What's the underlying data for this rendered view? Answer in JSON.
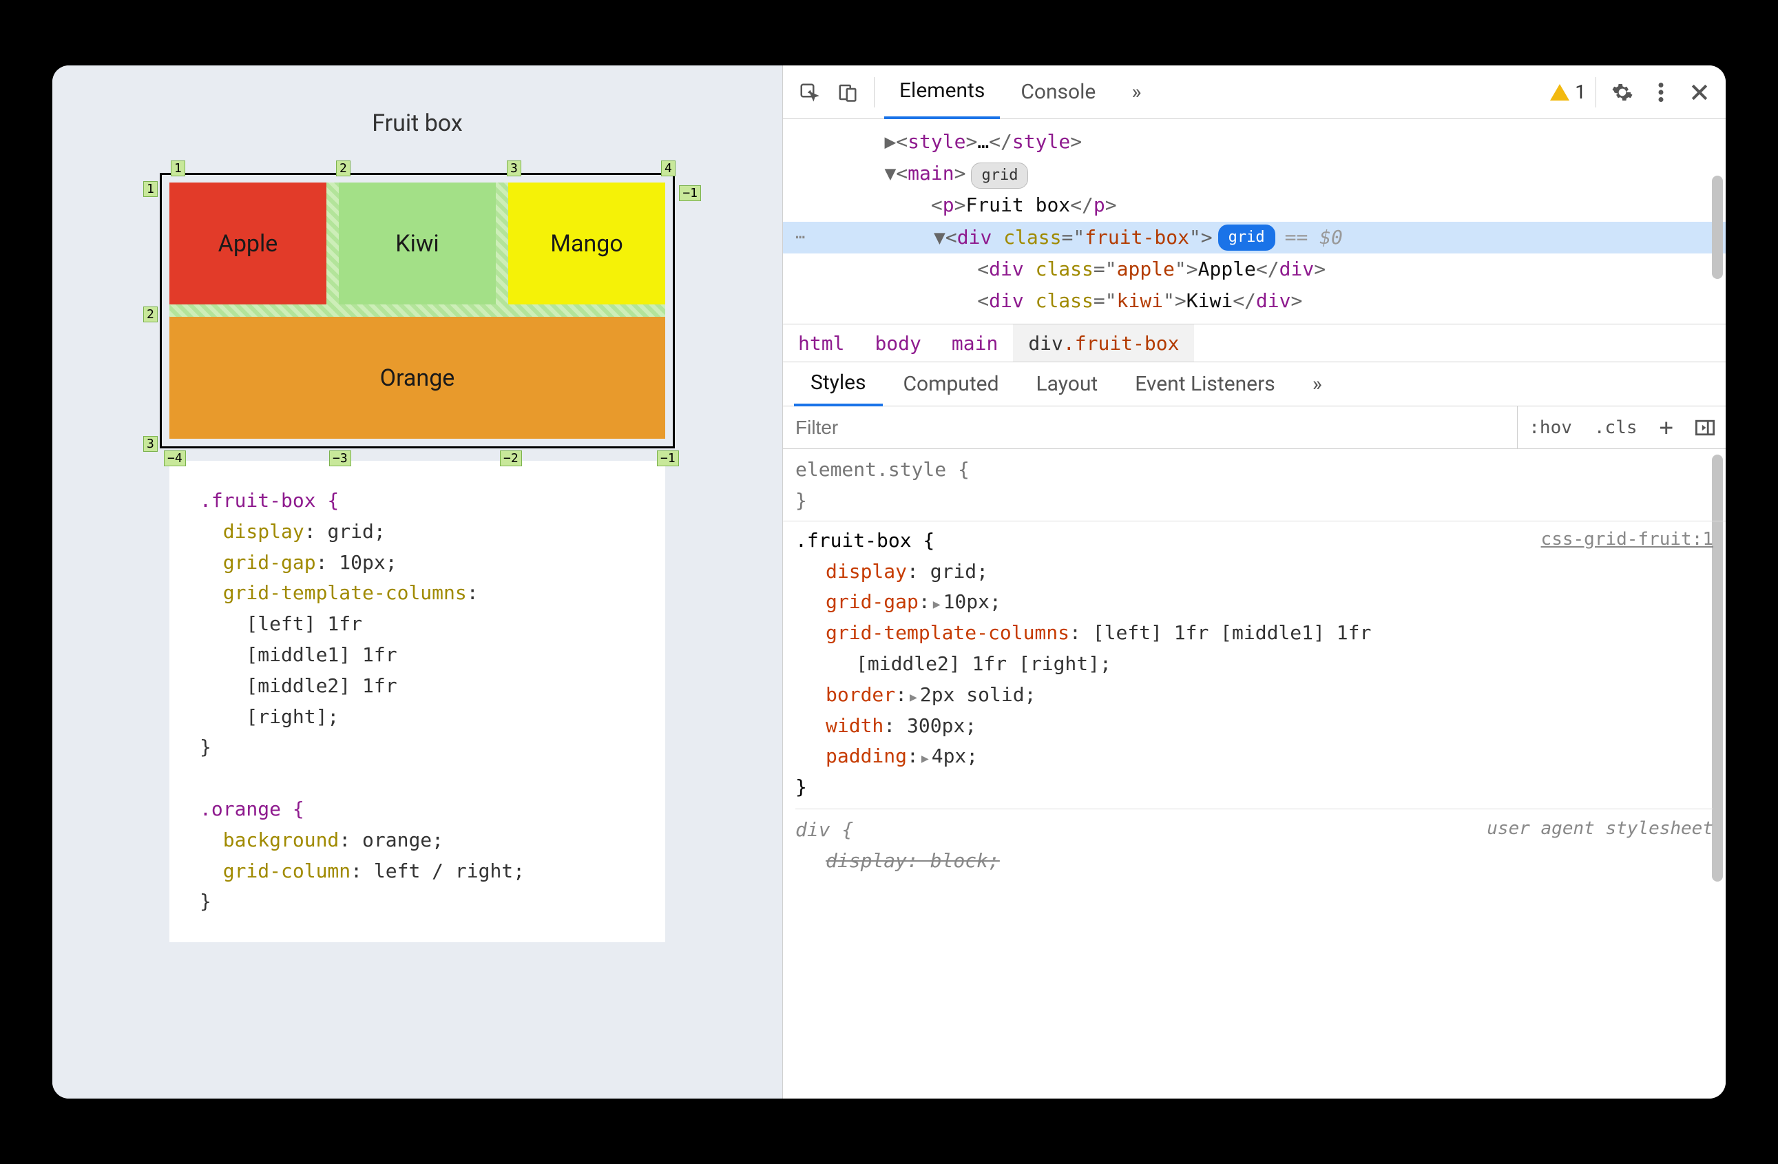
{
  "page": {
    "title": "Fruit box"
  },
  "grid": {
    "cells": {
      "apple": "Apple",
      "kiwi": "Kiwi",
      "mango": "Mango",
      "orange": "Orange"
    },
    "badges": {
      "top": [
        "1",
        "2",
        "3",
        "4"
      ],
      "bottom": [
        "−4",
        "−3",
        "−2",
        "−1"
      ],
      "left": [
        "1",
        "2",
        "3"
      ],
      "right": [
        "−1"
      ]
    }
  },
  "code_left": {
    "rule1_sel": ".fruit-box {",
    "rule1_l1a": "display",
    "rule1_l1b": ": grid;",
    "rule1_l2a": "grid-gap",
    "rule1_l2b": ": 10px;",
    "rule1_l3a": "grid-template-columns",
    "rule1_l3b": ":",
    "rule1_l4": "    [left] 1fr",
    "rule1_l5": "    [middle1] 1fr",
    "rule1_l6": "    [middle2] 1fr",
    "rule1_l7": "    [right];",
    "rule1_close": "}",
    "rule2_sel": ".orange {",
    "rule2_l1a": "background",
    "rule2_l1b": ": orange;",
    "rule2_l2a": "grid-column",
    "rule2_l2b": ": left / right;",
    "rule2_close": "}"
  },
  "devtools": {
    "tabs": {
      "elements": "Elements",
      "console": "Console",
      "more": "»"
    },
    "warning_count": "1",
    "dom": {
      "l1": {
        "toggle": "▶",
        "o": "<",
        "tag": "style",
        "c": ">",
        "dots": "…",
        "o2": "</",
        "tag2": "style",
        "c2": ">"
      },
      "l2": {
        "toggle": "▼",
        "o": "<",
        "tag": "main",
        "c": ">",
        "pill": "grid"
      },
      "l3": {
        "o": "<",
        "tag": "p",
        "c": ">",
        "txt": "Fruit box",
        "o2": "</",
        "tag2": "p",
        "c2": ">"
      },
      "l4": {
        "ell": "⋯",
        "toggle": "▼",
        "o": "<",
        "tag": "div",
        "sp": " ",
        "an": "class",
        "eq": "=\"",
        "av": "fruit-box",
        "q": "\"",
        "c": ">",
        "pill": "grid",
        "eq0": "== $0"
      },
      "l5": {
        "o": "<",
        "tag": "div",
        "sp": " ",
        "an": "class",
        "eq": "=\"",
        "av": "apple",
        "q": "\"",
        "c": ">",
        "txt": "Apple",
        "o2": "</",
        "tag2": "div",
        "c2": ">"
      },
      "l6": {
        "o": "<",
        "tag": "div",
        "sp": " ",
        "an": "class",
        "eq": "=\"",
        "av": "kiwi",
        "q": "\"",
        "c": ">",
        "txt": "Kiwi",
        "o2": "</",
        "tag2": "div",
        "c2": ">"
      }
    },
    "crumbs": {
      "c1": "html",
      "c2": "body",
      "c3": "main",
      "c4a": "div",
      "c4b": ".fruit-box"
    },
    "subtabs": {
      "styles": "Styles",
      "computed": "Computed",
      "layout": "Layout",
      "events": "Event Listeners",
      "more": "»"
    },
    "filter": {
      "placeholder": "Filter",
      "hov": ":hov",
      "cls": ".cls",
      "plus": "+"
    },
    "styles": {
      "el_style_open": "element.style {",
      "el_style_close": "}",
      "r1_sel": ".fruit-box {",
      "r1_src": "css-grid-fruit:1",
      "r1_d1n": "display",
      "r1_d1v": ": grid;",
      "r1_d2n": "grid-gap",
      "r1_d2v": "10px;",
      "r1_d3n": "grid-template-columns",
      "r1_d3v": ": [left] 1fr [middle1] 1fr",
      "r1_d3v2": "[middle2] 1fr [right];",
      "r1_d4n": "border",
      "r1_d4v": "2px solid;",
      "r1_d5n": "width",
      "r1_d5v": ": 300px;",
      "r1_d6n": "padding",
      "r1_d6v": "4px;",
      "r1_close": "}",
      "ua_sel": "div {",
      "ua_src": "user agent stylesheet",
      "ua_d1n": "display",
      "ua_d1v": ": block;"
    }
  }
}
